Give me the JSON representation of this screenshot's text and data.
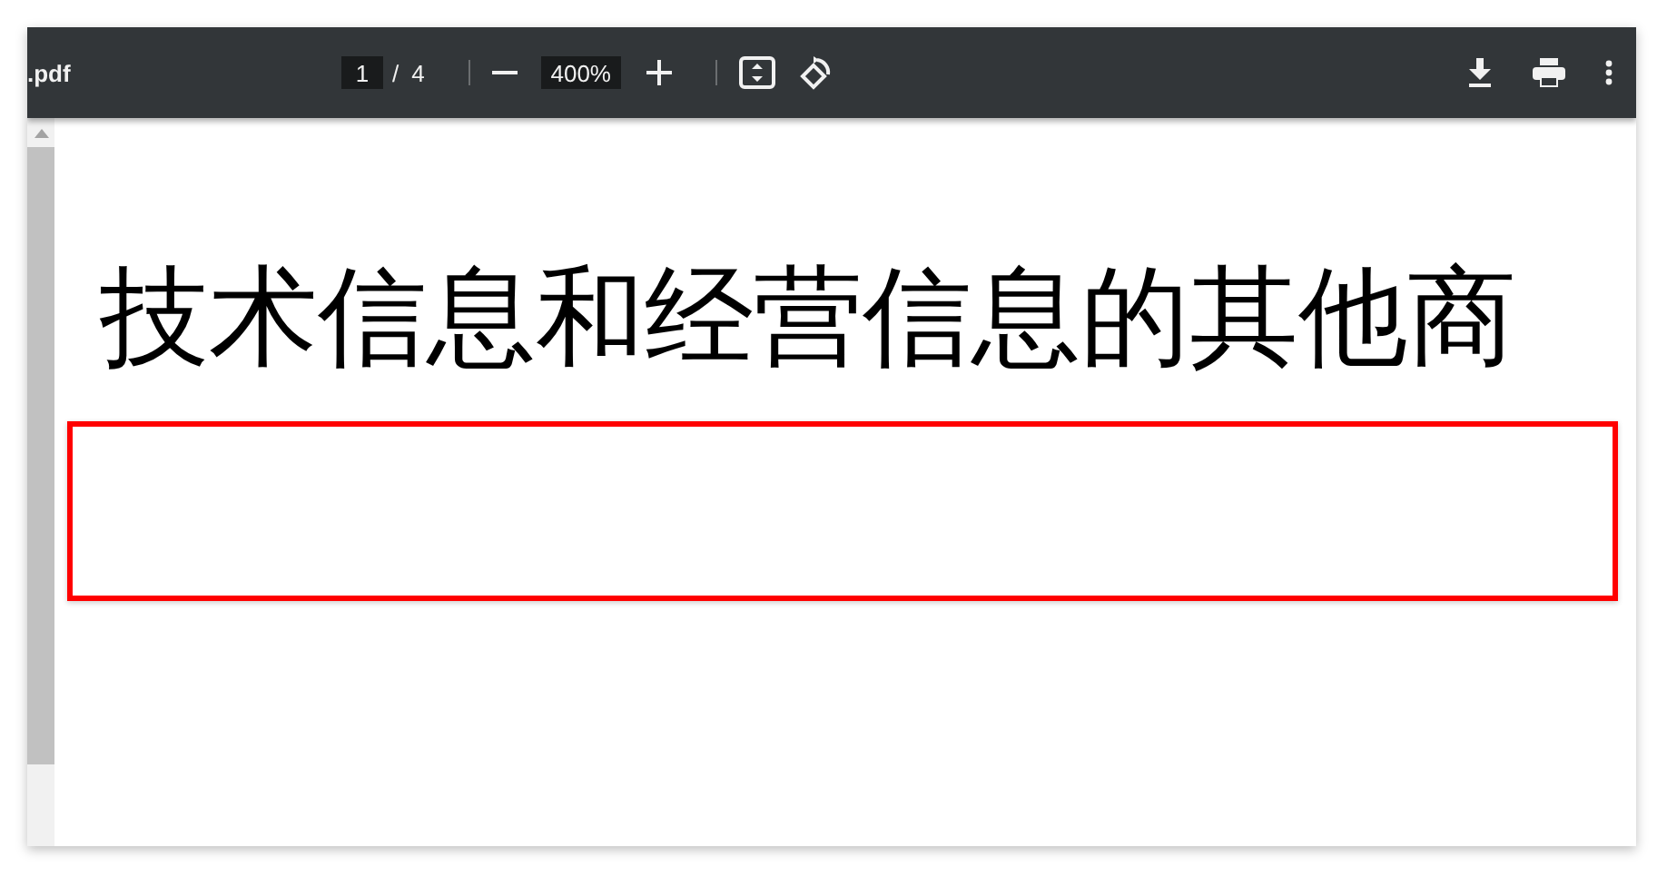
{
  "toolbar": {
    "title": ".pdf",
    "page_number": "1",
    "page_separator": "/",
    "page_count": "4",
    "zoom": "400%"
  },
  "document": {
    "heading": "技术信息和经营信息的其他商",
    "highlight_box": true
  }
}
